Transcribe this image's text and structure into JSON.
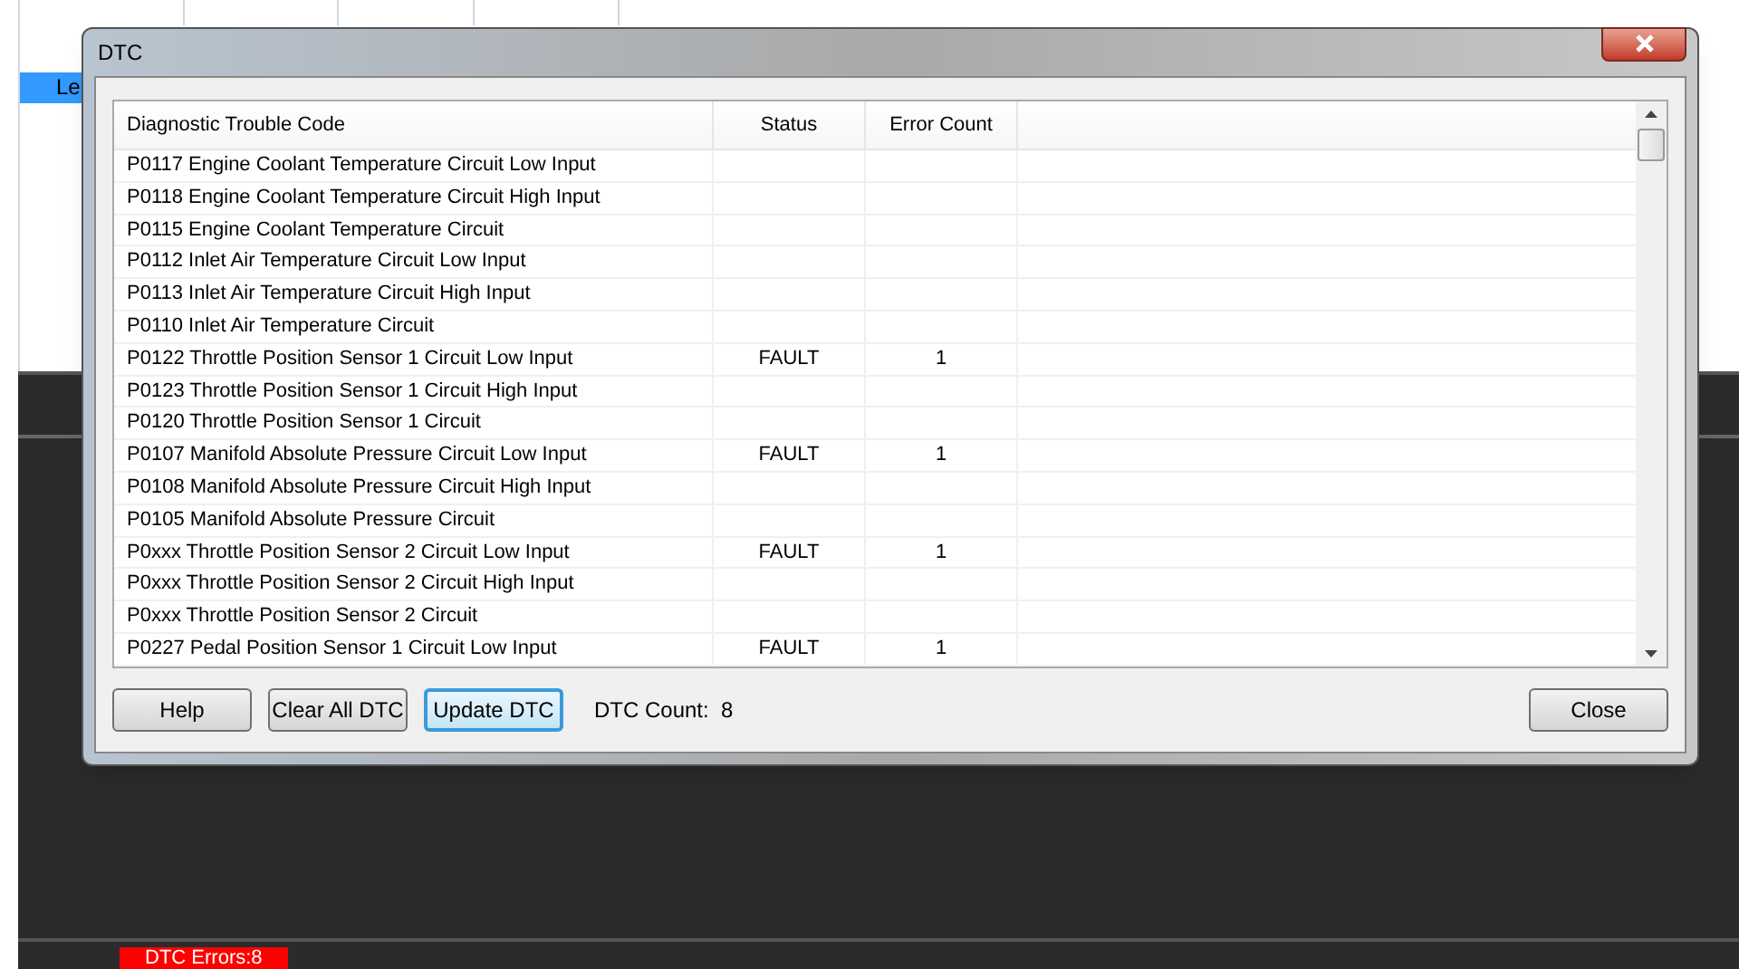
{
  "background": {
    "selected_cell": "Le",
    "status_badge": "DTC Errors:8"
  },
  "window": {
    "title": "DTC"
  },
  "table": {
    "columns": [
      "Diagnostic Trouble Code",
      "Status",
      "Error Count"
    ],
    "rows": [
      {
        "code": "P0117 Engine Coolant Temperature Circuit Low Input",
        "status": "",
        "count": ""
      },
      {
        "code": "P0118 Engine Coolant Temperature Circuit High Input",
        "status": "",
        "count": ""
      },
      {
        "code": "P0115 Engine Coolant Temperature Circuit",
        "status": "",
        "count": ""
      },
      {
        "code": "P0112 Inlet Air Temperature Circuit Low Input",
        "status": "",
        "count": ""
      },
      {
        "code": "P0113 Inlet Air Temperature Circuit High Input",
        "status": "",
        "count": ""
      },
      {
        "code": "P0110 Inlet Air Temperature Circuit",
        "status": "",
        "count": ""
      },
      {
        "code": "P0122 Throttle Position Sensor 1 Circuit Low Input",
        "status": "FAULT",
        "count": "1"
      },
      {
        "code": "P0123 Throttle Position Sensor 1 Circuit High Input",
        "status": "",
        "count": ""
      },
      {
        "code": "P0120 Throttle Position Sensor 1 Circuit",
        "status": "",
        "count": ""
      },
      {
        "code": "P0107 Manifold Absolute Pressure Circuit Low Input",
        "status": "FAULT",
        "count": "1"
      },
      {
        "code": "P0108 Manifold Absolute Pressure Circuit High Input",
        "status": "",
        "count": ""
      },
      {
        "code": "P0105 Manifold Absolute Pressure Circuit",
        "status": "",
        "count": ""
      },
      {
        "code": "P0xxx Throttle Position Sensor 2 Circuit Low Input",
        "status": "FAULT",
        "count": "1"
      },
      {
        "code": "P0xxx Throttle Position Sensor 2 Circuit High Input",
        "status": "",
        "count": ""
      },
      {
        "code": "P0xxx Throttle Position Sensor 2 Circuit",
        "status": "",
        "count": ""
      },
      {
        "code": "P0227 Pedal Position Sensor 1 Circuit Low Input",
        "status": "FAULT",
        "count": "1"
      }
    ]
  },
  "buttons": [
    {
      "label": "Help",
      "focused": false
    },
    {
      "label": "Clear All DTC",
      "focused": false
    },
    {
      "label": "Update DTC",
      "focused": true
    }
  ],
  "dtc_count": "DTC Count:  8",
  "close_button": "Close"
}
